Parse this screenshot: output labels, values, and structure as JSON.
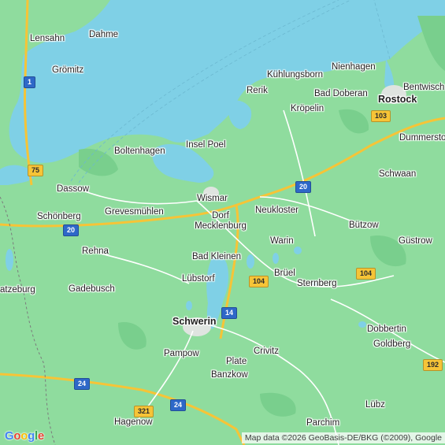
{
  "map": {
    "colors": {
      "land": "#8fdc9e",
      "water": "#7fd0e6",
      "forest": "#79cf8d",
      "road": "#ffffff",
      "highway": "#f6c437",
      "urban": "#dfe4e0"
    },
    "places": [
      {
        "name": "Lensahn",
        "type": "town"
      },
      {
        "name": "Dahme",
        "type": "town"
      },
      {
        "name": "Grömitz",
        "type": "town"
      },
      {
        "name": "Kühlungsborn",
        "type": "town"
      },
      {
        "name": "Nienhagen",
        "type": "town"
      },
      {
        "name": "Rerik",
        "type": "town"
      },
      {
        "name": "Bad Doberan",
        "type": "town"
      },
      {
        "name": "Rostock",
        "type": "city"
      },
      {
        "name": "Bentwisch",
        "type": "town"
      },
      {
        "name": "Kröpelin",
        "type": "town"
      },
      {
        "name": "Dummerstorf",
        "type": "town"
      },
      {
        "name": "Boltenhagen",
        "type": "town"
      },
      {
        "name": "Insel Poel",
        "type": "town"
      },
      {
        "name": "Schwaan",
        "type": "town"
      },
      {
        "name": "Dassow",
        "type": "town"
      },
      {
        "name": "Wismar",
        "type": "town"
      },
      {
        "name": "Neukloster",
        "type": "town"
      },
      {
        "name": "Schönberg",
        "type": "town"
      },
      {
        "name": "Grevesmühlen",
        "type": "town"
      },
      {
        "name": "Dorf Mecklenburg",
        "type": "town"
      },
      {
        "name": "Bützow",
        "type": "town"
      },
      {
        "name": "Warin",
        "type": "town"
      },
      {
        "name": "Güstrow",
        "type": "town"
      },
      {
        "name": "Rehna",
        "type": "town"
      },
      {
        "name": "Bad Kleinen",
        "type": "town"
      },
      {
        "name": "Brüel",
        "type": "town"
      },
      {
        "name": "atzeburg",
        "type": "town"
      },
      {
        "name": "Gadebusch",
        "type": "town"
      },
      {
        "name": "Lübstorf",
        "type": "town"
      },
      {
        "name": "Sternberg",
        "type": "town"
      },
      {
        "name": "Schwerin",
        "type": "city"
      },
      {
        "name": "Dobbertin",
        "type": "town"
      },
      {
        "name": "Goldberg",
        "type": "town"
      },
      {
        "name": "Pampow",
        "type": "town"
      },
      {
        "name": "Crivitz",
        "type": "town"
      },
      {
        "name": "Plate",
        "type": "town"
      },
      {
        "name": "Banzkow",
        "type": "town"
      },
      {
        "name": "Lübz",
        "type": "town"
      },
      {
        "name": "Hagenow",
        "type": "town"
      },
      {
        "name": "Parchim",
        "type": "town"
      }
    ],
    "shields": [
      {
        "label": "1",
        "color": "blue"
      },
      {
        "label": "75",
        "color": "yellow"
      },
      {
        "label": "20",
        "color": "blue"
      },
      {
        "label": "20",
        "color": "blue"
      },
      {
        "label": "103",
        "color": "yellow"
      },
      {
        "label": "104",
        "color": "yellow"
      },
      {
        "label": "104",
        "color": "yellow"
      },
      {
        "label": "14",
        "color": "blue"
      },
      {
        "label": "24",
        "color": "blue"
      },
      {
        "label": "321",
        "color": "yellow"
      },
      {
        "label": "24",
        "color": "blue"
      },
      {
        "label": "192",
        "color": "yellow"
      }
    ],
    "logo": "Google",
    "attribution": "Map data ©2026 GeoBasis-DE/BKG (©2009), Google"
  }
}
